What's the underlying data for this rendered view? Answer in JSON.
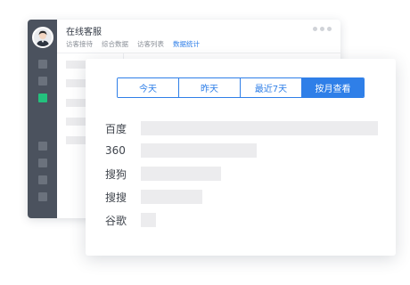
{
  "back_window": {
    "title": "在线客服",
    "tabs": [
      {
        "label": "访客接待",
        "active": false
      },
      {
        "label": "综合数据",
        "active": false
      },
      {
        "label": "访客列表",
        "active": false
      },
      {
        "label": "数据统计",
        "active": true
      }
    ]
  },
  "front_panel": {
    "range_buttons": [
      {
        "label": "今天",
        "active": false
      },
      {
        "label": "昨天",
        "active": false
      },
      {
        "label": "最近7天",
        "active": false
      },
      {
        "label": "按月查看",
        "active": true
      }
    ],
    "sources": [
      {
        "name": "百度",
        "share": 1.0
      },
      {
        "name": "360",
        "share": 0.49
      },
      {
        "name": "搜狗",
        "share": 0.34
      },
      {
        "name": "搜搜",
        "share": 0.26
      },
      {
        "name": "谷歌",
        "share": 0.065
      }
    ]
  },
  "colors": {
    "accent": "#2f7fe8",
    "sidebar": "#4b525e",
    "active_nav": "#23c17d",
    "placeholder": "#ececee"
  }
}
